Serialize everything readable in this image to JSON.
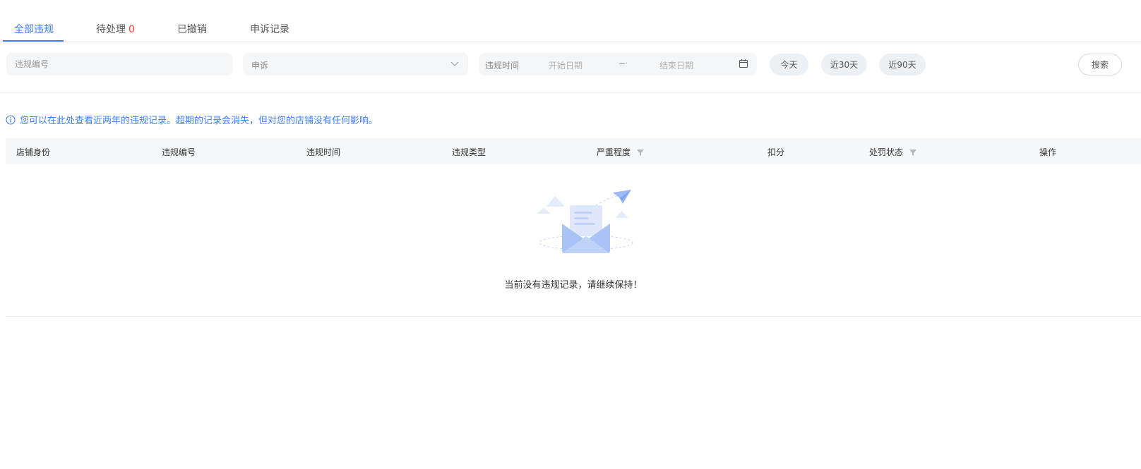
{
  "tabs": [
    {
      "label": "全部违规",
      "active": true
    },
    {
      "label": "待处理",
      "count": "0"
    },
    {
      "label": "已撤销"
    },
    {
      "label": "申诉记录"
    }
  ],
  "filters": {
    "violation_no_placeholder": "违规编号",
    "appeal_select_value": "申诉",
    "date_label": "违规时间",
    "start_placeholder": "开始日期",
    "date_separator": "~",
    "end_placeholder": "结束日期",
    "quick_today": "今天",
    "quick_30": "近30天",
    "quick_90": "近90天",
    "search_label": "搜索"
  },
  "notice": "您可以在此处查看近两年的违规记录。超期的记录会消失，但对您的店铺没有任何影响。",
  "table": {
    "columns": [
      "店铺身份",
      "违规编号",
      "违规时间",
      "违规类型",
      "严重程度",
      "扣分",
      "处罚状态",
      "操作"
    ],
    "empty_text": "当前没有违规记录，请继续保持！"
  },
  "colors": {
    "accent": "#3c7eff",
    "count_red": "#ff3b30",
    "field_bg": "#f5f6f7",
    "header_bg": "#f6f7f8"
  }
}
